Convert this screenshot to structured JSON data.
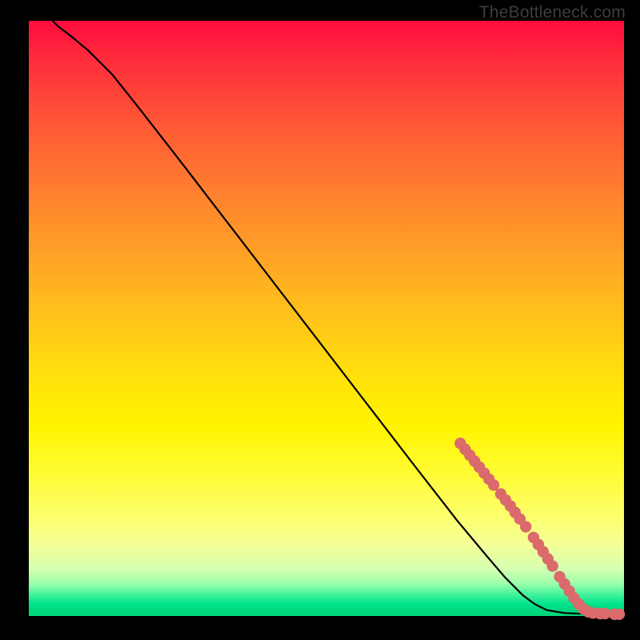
{
  "watermark": "TheBottleneck.com",
  "colors": {
    "dot": "#da6a6b",
    "curve": "#000000",
    "gradient_top": "#ff0b3e",
    "gradient_bottom_green": "#00d879"
  },
  "chart_data": {
    "type": "line",
    "title": "",
    "xlabel": "",
    "ylabel": "",
    "xlim": [
      0,
      100
    ],
    "ylim": [
      0,
      100
    ],
    "curve": [
      {
        "x": 4,
        "y": 100
      },
      {
        "x": 5,
        "y": 99
      },
      {
        "x": 7,
        "y": 97.5
      },
      {
        "x": 10,
        "y": 95
      },
      {
        "x": 14,
        "y": 91
      },
      {
        "x": 18,
        "y": 86
      },
      {
        "x": 25,
        "y": 77
      },
      {
        "x": 35,
        "y": 64
      },
      {
        "x": 45,
        "y": 51
      },
      {
        "x": 55,
        "y": 38
      },
      {
        "x": 65,
        "y": 25
      },
      {
        "x": 72,
        "y": 16
      },
      {
        "x": 77,
        "y": 10
      },
      {
        "x": 80,
        "y": 6.5
      },
      {
        "x": 83,
        "y": 3.5
      },
      {
        "x": 85,
        "y": 2
      },
      {
        "x": 87,
        "y": 1
      },
      {
        "x": 90,
        "y": 0.5
      },
      {
        "x": 95,
        "y": 0.3
      },
      {
        "x": 100,
        "y": 0.3
      }
    ],
    "points": [
      {
        "x": 72.5,
        "y": 29
      },
      {
        "x": 73.3,
        "y": 28
      },
      {
        "x": 74.1,
        "y": 27
      },
      {
        "x": 74.9,
        "y": 26
      },
      {
        "x": 75.7,
        "y": 25
      },
      {
        "x": 76.5,
        "y": 24
      },
      {
        "x": 77.3,
        "y": 23
      },
      {
        "x": 78.1,
        "y": 22
      },
      {
        "x": 79.3,
        "y": 20.5
      },
      {
        "x": 80.1,
        "y": 19.5
      },
      {
        "x": 80.9,
        "y": 18.5
      },
      {
        "x": 81.7,
        "y": 17.4
      },
      {
        "x": 82.5,
        "y": 16.3
      },
      {
        "x": 83.5,
        "y": 15
      },
      {
        "x": 84.8,
        "y": 13.2
      },
      {
        "x": 85.6,
        "y": 12
      },
      {
        "x": 86.4,
        "y": 10.8
      },
      {
        "x": 87.2,
        "y": 9.6
      },
      {
        "x": 88.0,
        "y": 8.4
      },
      {
        "x": 89.2,
        "y": 6.6
      },
      {
        "x": 90.0,
        "y": 5.4
      },
      {
        "x": 90.8,
        "y": 4.2
      },
      {
        "x": 91.6,
        "y": 3.0
      },
      {
        "x": 92.4,
        "y": 2.0
      },
      {
        "x": 93.2,
        "y": 1.2
      },
      {
        "x": 94.0,
        "y": 0.7
      },
      {
        "x": 94.8,
        "y": 0.5
      },
      {
        "x": 96.0,
        "y": 0.4
      },
      {
        "x": 96.8,
        "y": 0.4
      },
      {
        "x": 98.4,
        "y": 0.3
      },
      {
        "x": 99.2,
        "y": 0.3
      }
    ]
  }
}
